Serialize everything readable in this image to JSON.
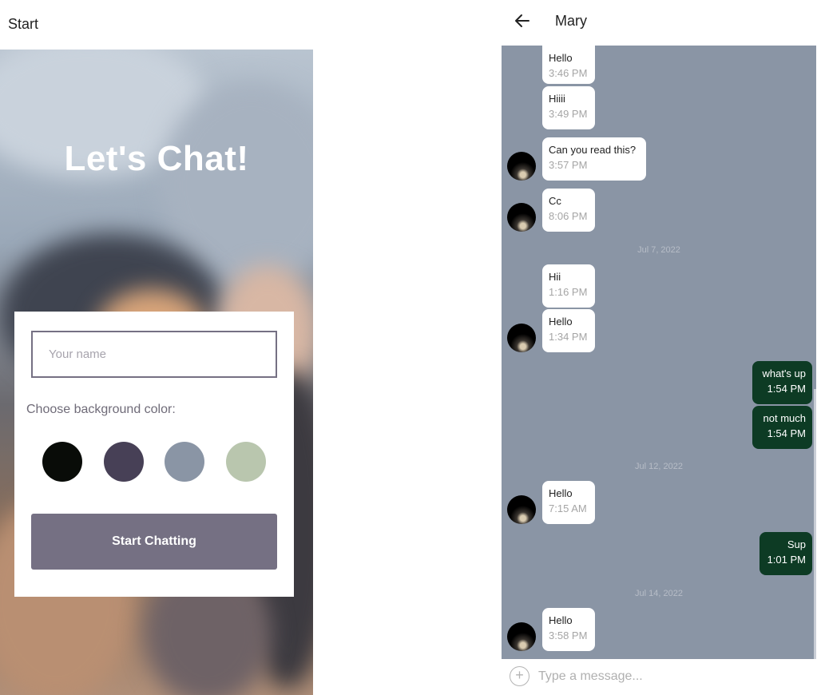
{
  "start": {
    "header_title": "Start",
    "app_title": "Let's Chat!",
    "name_placeholder": "Your name",
    "name_value": "",
    "color_label": "Choose background color:",
    "colors": [
      "#090C08",
      "#474056",
      "#8A95A5",
      "#B9C6AE"
    ],
    "button_label": "Start Chatting"
  },
  "chat": {
    "title": "Mary",
    "input_placeholder": "Type a message...",
    "messages": [
      {
        "type": "msg",
        "side": "left",
        "text": "Hello",
        "time": "3:46 PM",
        "avatar": false
      },
      {
        "type": "msg",
        "side": "left",
        "text": "Hiiii",
        "time": "3:49 PM",
        "avatar": false
      },
      {
        "type": "msg",
        "side": "left",
        "text": "Can you read this?",
        "time": "3:57 PM",
        "avatar": true
      },
      {
        "type": "msg",
        "side": "left",
        "text": "Cc",
        "time": "8:06 PM",
        "avatar": true
      },
      {
        "type": "day",
        "text": "Jul 7, 2022"
      },
      {
        "type": "msg",
        "side": "left",
        "text": "Hii",
        "time": "1:16 PM",
        "avatar": false
      },
      {
        "type": "msg",
        "side": "left",
        "text": "Hello",
        "time": "1:34 PM",
        "avatar": true
      },
      {
        "type": "msg",
        "side": "right",
        "text": "what's up",
        "time": "1:54 PM"
      },
      {
        "type": "msg",
        "side": "right",
        "text": "not much",
        "time": "1:54 PM"
      },
      {
        "type": "day",
        "text": "Jul 12, 2022"
      },
      {
        "type": "msg",
        "side": "left",
        "text": "Hello",
        "time": "7:15 AM",
        "avatar": true
      },
      {
        "type": "msg",
        "side": "right",
        "text": "Sup",
        "time": "1:01 PM"
      },
      {
        "type": "day",
        "text": "Jul 14, 2022"
      },
      {
        "type": "msg",
        "side": "left",
        "text": "Hello",
        "time": "3:58 PM",
        "avatar": true
      }
    ]
  }
}
